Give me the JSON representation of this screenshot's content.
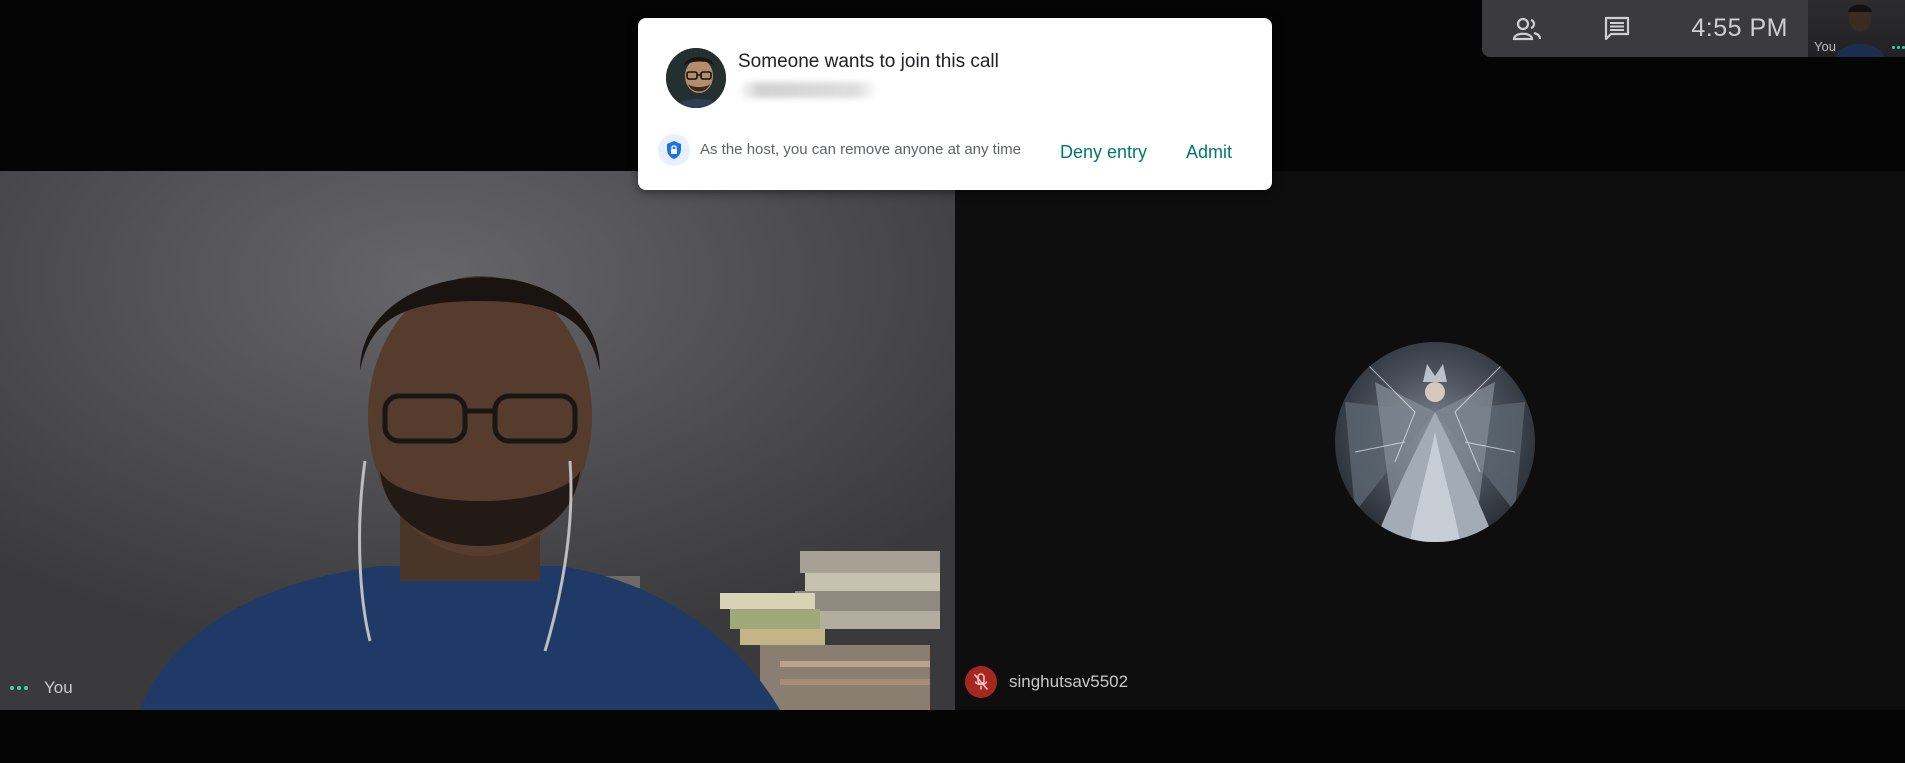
{
  "dialog": {
    "title": "Someone wants to join this call",
    "note": "As the host, you can remove anyone at any time",
    "deny_label": "Deny entry",
    "admit_label": "Admit"
  },
  "topbar": {
    "people_icon": "people-icon",
    "chat_icon": "chat-icon",
    "time": "4:55  PM",
    "self_thumb_label": "You"
  },
  "tiles": {
    "self_label": "You",
    "remote_label": "singhutsav5502"
  },
  "colors": {
    "accent_teal": "#00796b",
    "mic_off_red": "#a5271f",
    "dots_green": "#3ad6a6",
    "shield_blue": "#1a73e8"
  }
}
